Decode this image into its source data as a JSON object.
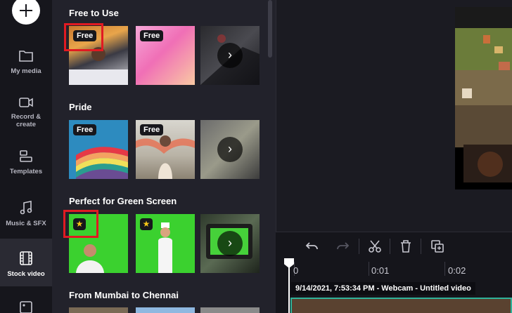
{
  "sidebar": {
    "items": [
      {
        "label": "My media",
        "icon": "folder-icon"
      },
      {
        "label": "Record & create",
        "icon": "camera-icon"
      },
      {
        "label": "Templates",
        "icon": "templates-icon"
      },
      {
        "label": "Music & SFX",
        "icon": "music-icon"
      },
      {
        "label": "Stock video",
        "icon": "film-icon"
      },
      {
        "label": "",
        "icon": "image-icon"
      }
    ]
  },
  "sections": [
    {
      "title": "Free to Use",
      "badges": [
        "Free",
        "Free"
      ]
    },
    {
      "title": "Pride",
      "badges": [
        "Free",
        "Free"
      ]
    },
    {
      "title": "Perfect for Green Screen"
    },
    {
      "title": "From Mumbai to Chennai"
    }
  ],
  "timeline": {
    "ticks": [
      "0",
      "0:01",
      "0:02"
    ],
    "clip_label": "9/14/2021, 7:53:34 PM - Webcam - Untitled video"
  },
  "colors": {
    "highlight": "#e11a22",
    "accent": "#2fb39a",
    "premium_star": "#f5c518"
  }
}
